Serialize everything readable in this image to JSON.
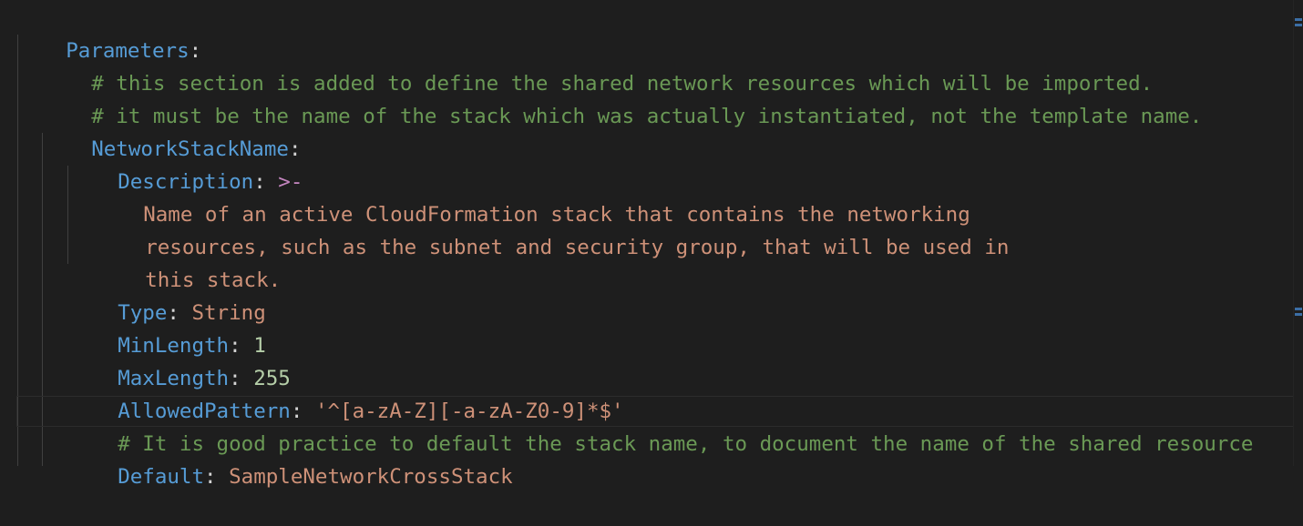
{
  "editor": {
    "colors": {
      "background": "#1e1e1e",
      "key": "#569cd6",
      "string": "#ce9178",
      "number": "#b5cea8",
      "comment": "#6a9955",
      "indicator": "#c586c0"
    },
    "lines": {
      "l1_key": "Parameters",
      "l2_comment": "# this section is added to define the shared network resources which will be imported.",
      "l3_comment": "# it must be the name of the stack which was actually instantiated, not the template name.",
      "l4_key": "NetworkStackName",
      "l5_key": "Description",
      "l5_value": ">-",
      "l6_text": "Name of an active CloudFormation stack that contains the networking",
      "l7_text": "resources, such as the subnet and security group, that will be used in",
      "l8_text": "this stack.",
      "l9_key": "Type",
      "l9_value": "String",
      "l10_key": "MinLength",
      "l10_value": "1",
      "l11_key": "MaxLength",
      "l11_value": "255",
      "l12_key": "AllowedPattern",
      "l12_value": "'^[a-zA-Z][-a-zA-Z0-9]*$'",
      "l13_comment": "# It is good practice to default the stack name, to document the name of the shared resource",
      "l14_key": "Default",
      "l14_value": "SampleNetworkCrossStack"
    }
  }
}
